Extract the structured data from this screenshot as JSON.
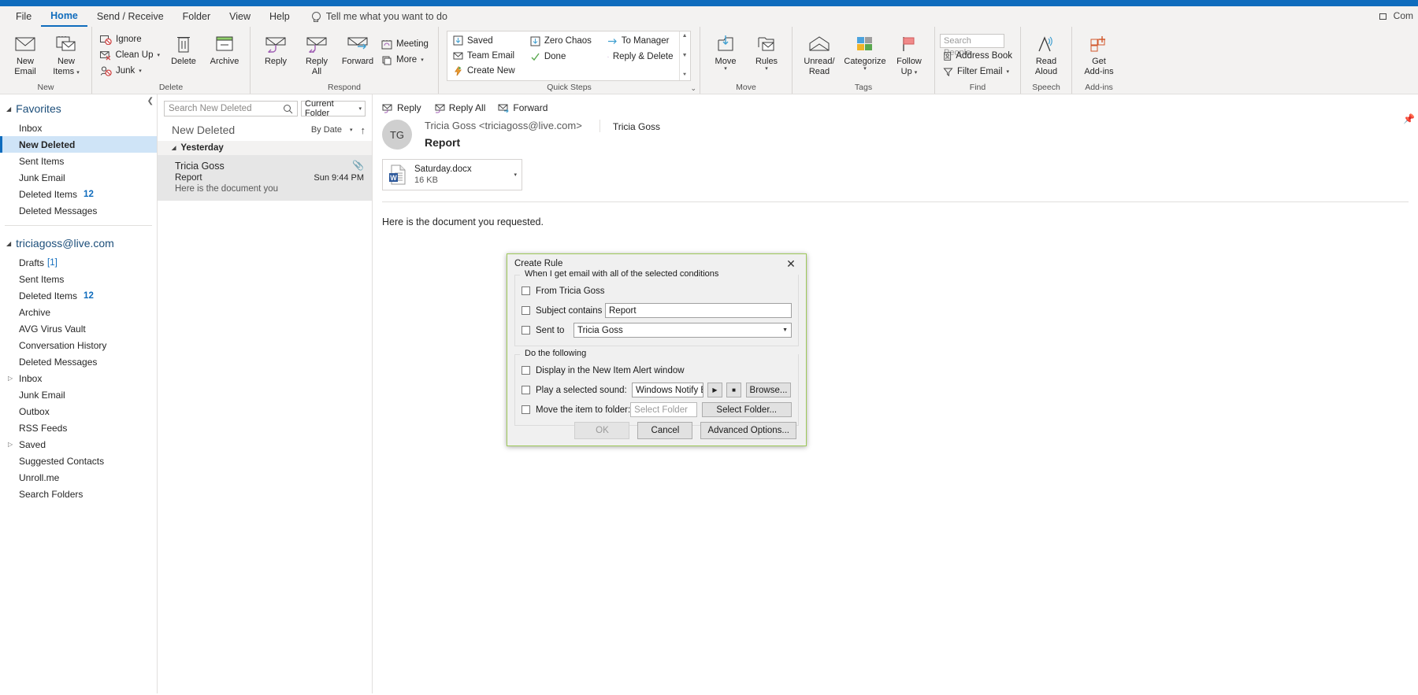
{
  "window": {
    "title_right": "Com"
  },
  "tabs": [
    {
      "label": "File",
      "active": false
    },
    {
      "label": "Home",
      "active": true
    },
    {
      "label": "Send / Receive",
      "active": false
    },
    {
      "label": "Folder",
      "active": false
    },
    {
      "label": "View",
      "active": false
    },
    {
      "label": "Help",
      "active": false
    }
  ],
  "tellme": "Tell me what you want to do",
  "ribbon": {
    "groups": [
      {
        "label": "New"
      },
      {
        "label": "Delete"
      },
      {
        "label": "Respond"
      },
      {
        "label": "Quick Steps"
      },
      {
        "label": "Move"
      },
      {
        "label": "Tags"
      },
      {
        "label": "Find"
      },
      {
        "label": "Speech"
      },
      {
        "label": "Add-ins"
      }
    ],
    "new": {
      "new_email": "New\nEmail",
      "new_email_l1": "New",
      "new_email_l2": "Email",
      "new_items_l1": "New",
      "new_items_l2": "Items"
    },
    "delete": {
      "ignore": "Ignore",
      "clean_up": "Clean Up",
      "junk": "Junk",
      "delete": "Delete",
      "archive": "Archive"
    },
    "respond": {
      "reply": "Reply",
      "reply_all_l1": "Reply",
      "reply_all_l2": "All",
      "forward": "Forward",
      "meeting": "Meeting",
      "more": "More"
    },
    "quick_steps": [
      "Saved",
      "Zero Chaos",
      "To Manager",
      "Team Email",
      "Done",
      "Reply & Delete",
      "Create New"
    ],
    "move": {
      "move": "Move",
      "rules": "Rules"
    },
    "tags": {
      "unread_l1": "Unread/",
      "unread_l2": "Read",
      "categorize": "Categorize",
      "followup_l1": "Follow",
      "followup_l2": "Up"
    },
    "find": {
      "search_people_placeholder": "Search People",
      "address_book": "Address Book",
      "filter_email": "Filter Email"
    },
    "speech": {
      "read_aloud_l1": "Read",
      "read_aloud_l2": "Aloud"
    },
    "addins": {
      "get_addins_l1": "Get",
      "get_addins_l2": "Add-ins"
    }
  },
  "sidebar": {
    "favorites_header": "Favorites",
    "favorites": [
      {
        "label": "Inbox",
        "count": "",
        "selected": false
      },
      {
        "label": "New Deleted",
        "count": "",
        "selected": true
      },
      {
        "label": "Sent Items",
        "count": "",
        "selected": false
      },
      {
        "label": "Junk Email",
        "count": "",
        "selected": false
      },
      {
        "label": "Deleted Items",
        "count": "12",
        "selected": false
      },
      {
        "label": "Deleted Messages",
        "count": "",
        "selected": false
      }
    ],
    "account_header": "triciagoss@live.com",
    "account_folders": [
      {
        "label": "Drafts",
        "draft": "[1]",
        "count": "",
        "expand": false
      },
      {
        "label": "Sent Items",
        "draft": "",
        "count": "",
        "expand": false
      },
      {
        "label": "Deleted Items",
        "draft": "",
        "count": "12",
        "expand": false
      },
      {
        "label": "Archive",
        "draft": "",
        "count": "",
        "expand": false
      },
      {
        "label": "AVG Virus Vault",
        "draft": "",
        "count": "",
        "expand": false
      },
      {
        "label": "Conversation History",
        "draft": "",
        "count": "",
        "expand": false
      },
      {
        "label": "Deleted Messages",
        "draft": "",
        "count": "",
        "expand": false
      },
      {
        "label": "Inbox",
        "draft": "",
        "count": "",
        "expand": true
      },
      {
        "label": "Junk Email",
        "draft": "",
        "count": "",
        "expand": false
      },
      {
        "label": "Outbox",
        "draft": "",
        "count": "",
        "expand": false
      },
      {
        "label": "RSS Feeds",
        "draft": "",
        "count": "",
        "expand": false
      },
      {
        "label": "Saved",
        "draft": "",
        "count": "",
        "expand": true
      },
      {
        "label": "Suggested Contacts",
        "draft": "",
        "count": "",
        "expand": false
      },
      {
        "label": "Unroll.me",
        "draft": "",
        "count": "",
        "expand": false
      },
      {
        "label": "Search Folders",
        "draft": "",
        "count": "",
        "expand": false
      }
    ]
  },
  "list": {
    "search_placeholder": "Search New Deleted",
    "scope": "Current Folder",
    "folder_title": "New Deleted",
    "sort_label": "By Date",
    "group_label": "Yesterday",
    "messages": [
      {
        "from": "Tricia Goss",
        "subject": "Report",
        "preview": "Here is the document you",
        "date": "Sun 9:44 PM",
        "has_attachment": true,
        "selected": true
      }
    ]
  },
  "reading": {
    "actions": [
      "Reply",
      "Reply All",
      "Forward"
    ],
    "avatar_initials": "TG",
    "from": "Tricia Goss <triciagoss@live.com>",
    "contact": "Tricia Goss",
    "subject": "Report",
    "attachment": {
      "name": "Saturday.docx",
      "size": "16 KB",
      "icon": "word-icon"
    },
    "body": "Here is the document you requested."
  },
  "dialog": {
    "title": "Create Rule",
    "close_label": "✕",
    "conditions_legend": "When I get email with all of the selected conditions",
    "conditions": [
      {
        "type": "checkbox_only",
        "label": "From Tricia Goss",
        "checked": false
      },
      {
        "type": "checkbox_text",
        "label": "Subject contains",
        "checked": false,
        "value": "Report"
      },
      {
        "type": "checkbox_combo",
        "label": "Sent to",
        "checked": false,
        "value": "Tricia Goss"
      }
    ],
    "actions_legend": "Do the following",
    "actions": [
      {
        "type": "checkbox_only",
        "label": "Display in the New Item Alert window",
        "checked": false
      },
      {
        "type": "checkbox_sound",
        "label": "Play a selected sound:",
        "checked": false,
        "value": "Windows Notify Em",
        "browse_label": "Browse...",
        "play_icon": "play-icon",
        "stop_icon": "stop-icon"
      },
      {
        "type": "checkbox_folder",
        "label": "Move the item to folder:",
        "checked": false,
        "placeholder": "Select Folder",
        "select_label": "Select Folder..."
      }
    ],
    "buttons": [
      {
        "label": "OK",
        "disabled": true
      },
      {
        "label": "Cancel",
        "disabled": false
      },
      {
        "label": "Advanced Options...",
        "disabled": false
      }
    ]
  },
  "colors": {
    "accent": "#0f6cbd",
    "dialog_border": "#9ec95a",
    "selection": "#cfe4f7",
    "word": "#2b579a"
  }
}
